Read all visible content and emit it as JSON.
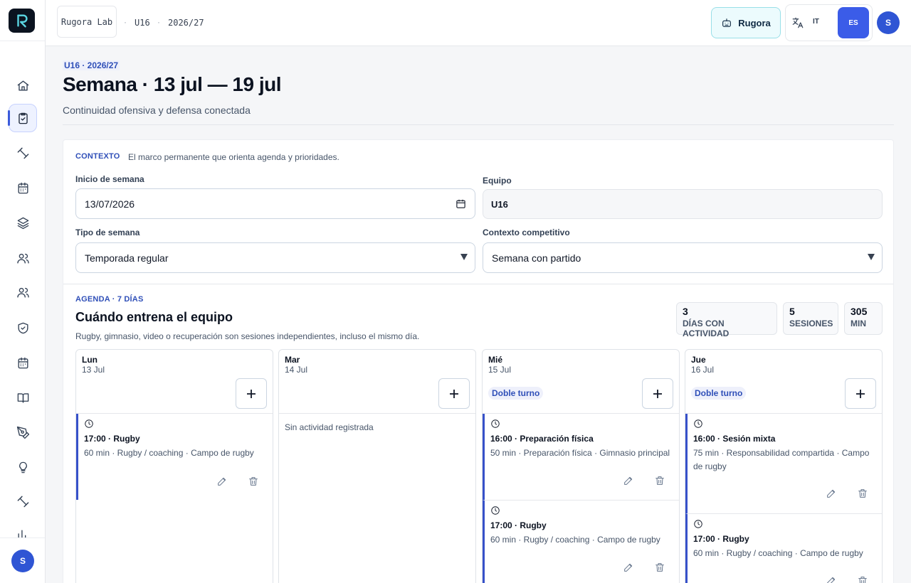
{
  "topbar": {
    "org": "Rugora Lab",
    "team": "U16",
    "season": "2026/27",
    "separator": "·",
    "assistant_label": "Rugora",
    "lang_it": "IT",
    "lang_es": "ES",
    "user_initial": "S"
  },
  "sidebar": {
    "items": [
      "home-icon",
      "clipboard-check-icon",
      "dumbbell-icon",
      "calendar-icon",
      "layers-icon",
      "users-icon",
      "users-alt-icon",
      "shield-check-icon",
      "calendar-alt-icon",
      "book-open-icon",
      "pen-tool-icon",
      "lightbulb-icon",
      "dumbbell-alt-icon",
      "bar-chart-icon"
    ],
    "active_item": "clipboard-check-icon",
    "user_initial": "S"
  },
  "header": {
    "eyebrow": "U16 · 2026/27",
    "title": "Semana · 13 jul — 19 jul",
    "subtitle": "Continuidad ofensiva y defensa conectada"
  },
  "context": {
    "tag": "CONTEXTO",
    "description": "El marco permanente que orienta agenda y prioridades.",
    "week_start_label": "Inicio de semana",
    "week_start_value": "13/07/2026",
    "team_label": "Equipo",
    "team_value": "U16",
    "week_type_label": "Tipo de semana",
    "week_type_value": "Temporada regular",
    "competitive_label": "Contexto competitivo",
    "competitive_value": "Semana con partido"
  },
  "agenda": {
    "tag": "AGENDA · 7 DÍAS",
    "title": "Cuándo entrena el equipo",
    "subtitle": "Rugby, gimnasio, video o recuperación son sesiones independientes, incluso el mismo día.",
    "stats": [
      {
        "value": "3",
        "label": "DÍAS CON ACTIVIDAD"
      },
      {
        "value": "5",
        "label": "SESIONES"
      },
      {
        "value": "305",
        "label": "MIN"
      }
    ],
    "days": [
      {
        "name": "Lun",
        "date": "13 Jul",
        "badge": "",
        "empty_text": "",
        "sessions": [
          {
            "title": "17:00 · Rugby",
            "meta": "60 min · Rugby / coaching · Campo de rugby"
          }
        ]
      },
      {
        "name": "Mar",
        "date": "14 Jul",
        "badge": "",
        "empty_text": "Sin actividad registrada",
        "sessions": []
      },
      {
        "name": "Mié",
        "date": "15 Jul",
        "badge": "Doble turno",
        "empty_text": "",
        "sessions": [
          {
            "title": "16:00 · Preparación física",
            "meta": "50 min · Preparación física · Gimnasio principal"
          },
          {
            "title": "17:00 · Rugby",
            "meta": "60 min · Rugby / coaching · Campo de rugby"
          }
        ]
      },
      {
        "name": "Jue",
        "date": "16 Jul",
        "badge": "Doble turno",
        "empty_text": "",
        "sessions": [
          {
            "title": "16:00 · Sesión mixta",
            "meta": "75 min · Responsabilidad compartida · Campo de rugby"
          },
          {
            "title": "17:00 · Rugby",
            "meta": "60 min · Rugby / coaching · Campo de rugby"
          }
        ]
      }
    ]
  },
  "colors": {
    "accent": "#3b5ce8",
    "session_bar": "#3751c9",
    "assistant_bg": "#ecfbfd"
  }
}
